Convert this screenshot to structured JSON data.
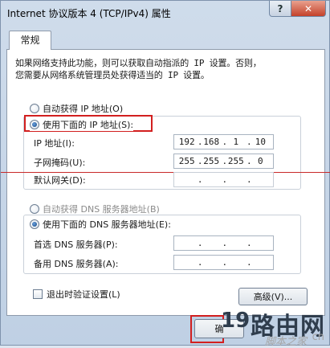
{
  "window": {
    "title": "Internet 协议版本 4 (TCP/IPv4) 属性",
    "help_glyph": "?",
    "close_glyph": "✕"
  },
  "tab": {
    "label": "常规"
  },
  "description": [
    "如果网络支持此功能，则可以获取自动指派的 IP 设置。否则，",
    "您需要从网络系统管理员处获得适当的 IP 设置。"
  ],
  "ip_section": {
    "auto_label": "自动获得 IP 地址(O)",
    "manual_label": "使用下面的 IP 地址(S):",
    "selected": "manual",
    "fields": [
      {
        "label": "IP 地址(I):",
        "octets": [
          "192",
          "168",
          "1",
          "10"
        ]
      },
      {
        "label": "子网掩码(U):",
        "octets": [
          "255",
          "255",
          "255",
          "0"
        ]
      },
      {
        "label": "默认网关(D):",
        "octets": [
          "",
          "",
          "",
          ""
        ]
      }
    ]
  },
  "dns_section": {
    "auto_label": "自动获得 DNS 服务器地址(B)",
    "manual_label": "使用下面的 DNS 服务器地址(E):",
    "selected": "manual",
    "fields": [
      {
        "label": "首选 DNS 服务器(P):",
        "octets": [
          "",
          "",
          "",
          ""
        ]
      },
      {
        "label": "备用 DNS 服务器(A):",
        "octets": [
          "",
          "",
          "",
          ""
        ]
      }
    ]
  },
  "validate": {
    "label": "退出时验证设置(L)",
    "checked": false
  },
  "buttons": {
    "advanced": "高级(V)...",
    "ok": "确"
  },
  "watermark": {
    "digits": "19",
    "brand": "路由网",
    "sub": "脚本之家",
    "suffix": "cn"
  },
  "colors": {
    "highlight": "#d21f1f"
  }
}
